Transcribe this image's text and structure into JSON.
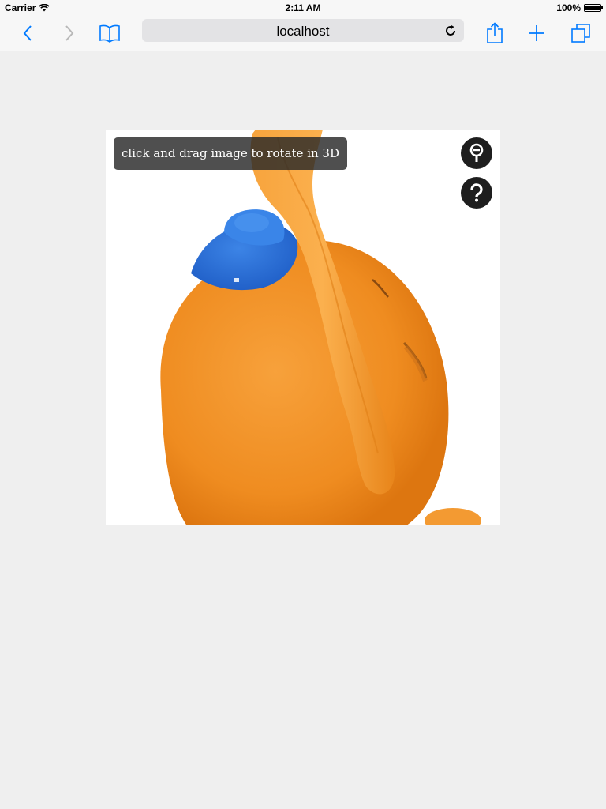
{
  "status_bar": {
    "carrier": "Carrier",
    "time": "2:11 AM",
    "battery": "100%"
  },
  "toolbar": {
    "url": "localhost",
    "icons": [
      "back-icon",
      "forward-icon",
      "bookmarks-icon",
      "reload-icon",
      "share-icon",
      "new-tab-icon",
      "tabs-icon"
    ]
  },
  "viewer": {
    "hint": "click and drag image to rotate in 3D",
    "buttons": [
      "zoom-icon",
      "help-icon"
    ]
  },
  "colors": {
    "accent": "#007aff",
    "plush_orange": "#f3962c",
    "hat_blue": "#2f72d6",
    "background": "#efefef"
  }
}
